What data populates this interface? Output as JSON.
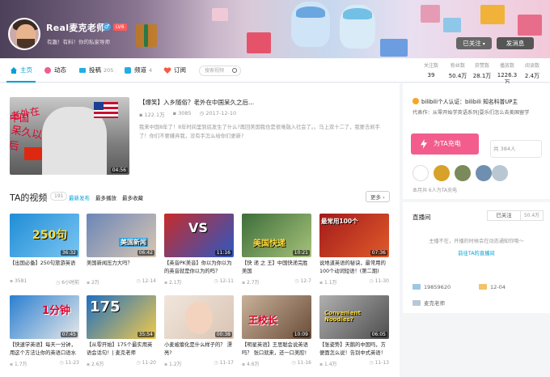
{
  "profile": {
    "name": "Real麦克老师",
    "gender_symbol": "♂",
    "level": "LV6",
    "signature": "有趣！有料！你的私家导师",
    "follow_label": "已关注",
    "message_label": "发消息"
  },
  "nav": {
    "tabs": [
      {
        "label": "主页",
        "count": ""
      },
      {
        "label": "动态",
        "count": ""
      },
      {
        "label": "投稿",
        "count": "205"
      },
      {
        "label": "频道",
        "count": "4"
      },
      {
        "label": "订阅",
        "count": ""
      }
    ],
    "search_placeholder": "搜索视频"
  },
  "stats": [
    {
      "label": "关注数",
      "value": "39"
    },
    {
      "label": "粉丝数",
      "value": "50.4万"
    },
    {
      "label": "获赞数",
      "value": "28.1万"
    },
    {
      "label": "播放数",
      "value": "1226.3万"
    },
    {
      "label": "阅读数",
      "value": "2.4万"
    }
  ],
  "featured": {
    "title": "【爆笑】入乡随俗？老外在中国呆久之后...",
    "plays": "122.1万",
    "comments": "3085",
    "date": "2017-12-10",
    "duration": "04:56",
    "description": "我来中国8年了！8年时间里到底发生了什么?再回美国我也是很难融入社会了。。马上双十二了，我要去剁手了！你们不要嫌弃我，没有手怎么给你们更新?",
    "thumb_text": [
      "老外在",
      "中国",
      "呆久以后"
    ]
  },
  "videos_section": {
    "title": "TA的视频",
    "count": "191",
    "sorts": [
      "最新发布",
      "最多播放",
      "最多收藏"
    ],
    "more_label": "更多"
  },
  "videos": [
    {
      "title": "【出国必备】250句旅游英语",
      "plays": "3581",
      "time": "6小时前",
      "duration": "36:32",
      "thumb_text": "250句"
    },
    {
      "title": "美国新闻压力大吗？",
      "plays": "2万",
      "time": "12-14",
      "duration": "06:42",
      "thumb_text": "美国新闻"
    },
    {
      "title": "【英音PK美音】你以为你以为的英音就是你以为的吗？",
      "plays": "2.1万",
      "time": "12-11",
      "duration": "11:16",
      "thumb_text": "VS"
    },
    {
      "title": "【快 递 之 王】中国快递完胜美国",
      "plays": "2.7万",
      "time": "12-7",
      "duration": "10:21",
      "thumb_text": "美国快递"
    },
    {
      "title": "说地道英语的秘诀，最常用的100个动词短语！(第二期)",
      "plays": "1.1万",
      "time": "11-30",
      "duration": "07:36",
      "thumb_text": "最常用100个"
    },
    {
      "title": "【快速学英语】每天一分钟，用这个方法让你的英语口语水",
      "plays": "1.7万",
      "time": "11-23",
      "duration": "07:45",
      "thumb_text": "1分钟"
    },
    {
      "title": "【从零开始】175个最实用英语会话句！| 麦克老师",
      "plays": "2.6万",
      "time": "11-20",
      "duration": "35:54",
      "thumb_text": "175"
    },
    {
      "title": "小麦被瘪化是什么样子的？ 漂亮?",
      "plays": "1.2万",
      "time": "11-17",
      "duration": "00:38",
      "thumb_text": ""
    },
    {
      "title": "【明星英语】王思聪会说英语吗？ 张口就来，还一口美腔!",
      "plays": "4.6万",
      "time": "11-16",
      "duration": "10:09",
      "thumb_text": "王校长"
    },
    {
      "title": "【张姿势】天鹅的中国吗，方便面怎么说！告别中式英语！",
      "plays": "1.4万",
      "time": "11-13",
      "duration": "06:05",
      "thumb_text": "Convenient Noodles?"
    }
  ],
  "sidebar": {
    "verify_text": "bilibili个人认证：bilibili 知名科普UP主",
    "works_text": "代表作：从零开始学英语系列|耍乐们怎么去美国留学",
    "charge_label": "为TA充电",
    "charge_total": "共 384人",
    "fans_note": "本月共 6人为TA充电",
    "live_title": "直播间",
    "live_follow": "已关注",
    "live_count": "50.4万",
    "live_empty": "主播不在，开播的时候会在动态通知你哦～",
    "live_link": "前往TA的直播间",
    "uid": "19859620",
    "birthday": "12-04",
    "tag": "麦克老师"
  },
  "colors": {
    "accent": "#00a1d6",
    "pink": "#f25d8e"
  }
}
